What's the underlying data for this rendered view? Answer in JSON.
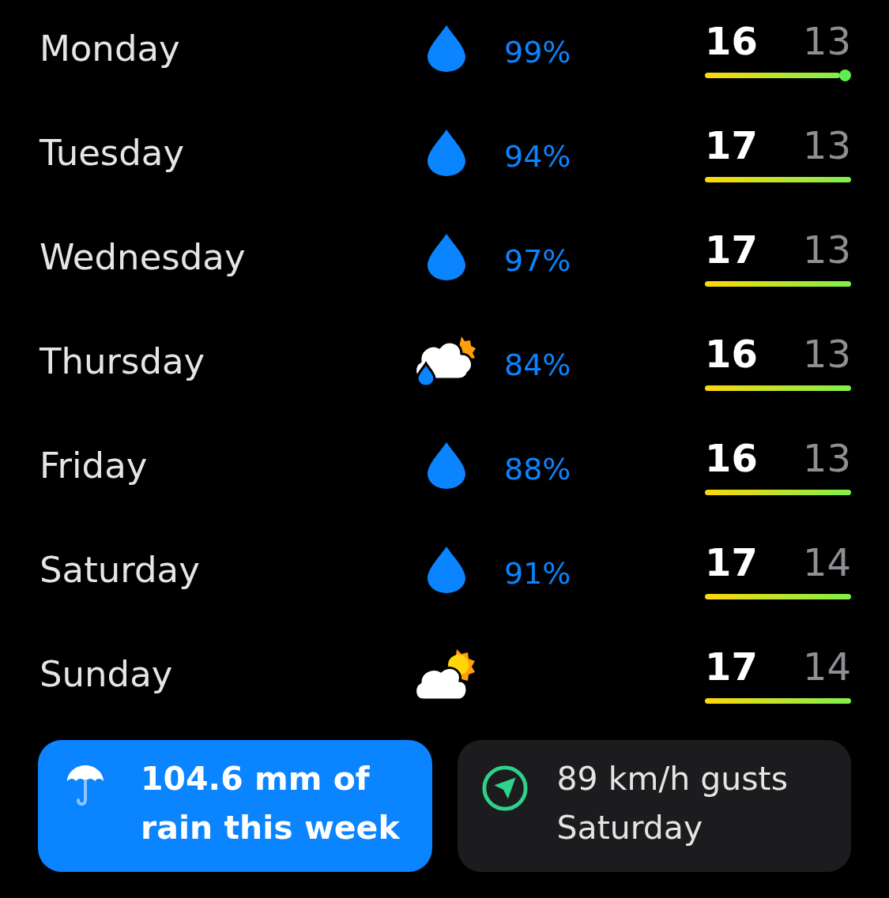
{
  "days": [
    {
      "name": "Monday",
      "kind": "rain",
      "precipitation": "99%",
      "high": "16",
      "low": "13",
      "current_marker": true
    },
    {
      "name": "Tuesday",
      "kind": "rain",
      "precipitation": "94%",
      "high": "17",
      "low": "13",
      "current_marker": false
    },
    {
      "name": "Wednesday",
      "kind": "rain",
      "precipitation": "97%",
      "high": "17",
      "low": "13",
      "current_marker": false
    },
    {
      "name": "Thursday",
      "kind": "showers",
      "precipitation": "84%",
      "high": "16",
      "low": "13",
      "current_marker": false
    },
    {
      "name": "Friday",
      "kind": "rain",
      "precipitation": "88%",
      "high": "16",
      "low": "13",
      "current_marker": false
    },
    {
      "name": "Saturday",
      "kind": "rain",
      "precipitation": "91%",
      "high": "17",
      "low": "14",
      "current_marker": false
    },
    {
      "name": "Sunday",
      "kind": "partly-cloudy",
      "high": "17",
      "low": "14",
      "current_marker": false
    }
  ],
  "cards": [
    {
      "kind": "rain",
      "text": "104.6 mm of rain this week"
    },
    {
      "kind": "wind",
      "text": "89 km/h gusts Saturday"
    }
  ]
}
